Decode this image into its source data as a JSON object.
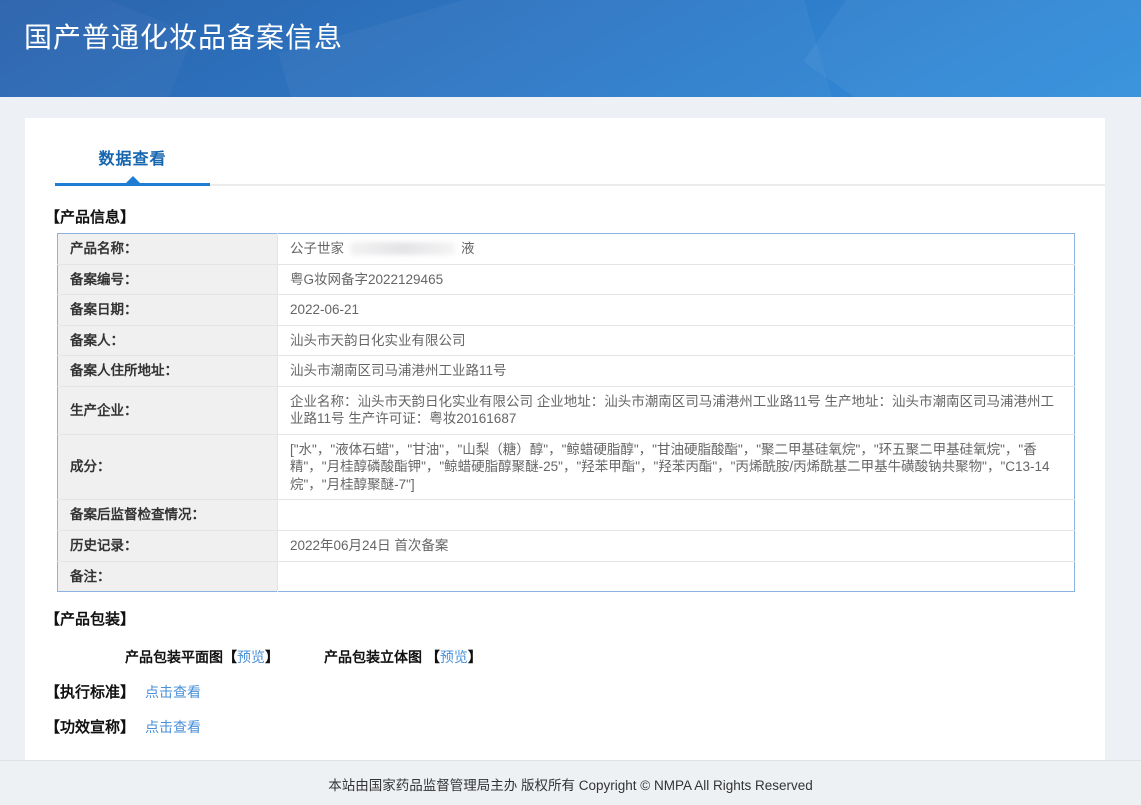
{
  "header": {
    "title": "国产普通化妆品备案信息"
  },
  "tabs": {
    "data_view_label": "数据查看"
  },
  "product_info": {
    "section_title": "【产品信息】",
    "rows": [
      {
        "label": "产品名称：",
        "redacted": true,
        "value_prefix": "公子世家",
        "value_suffix": "液"
      },
      {
        "label": "备案编号：",
        "value": "粤G妆网备字2022129465"
      },
      {
        "label": "备案日期：",
        "value": "2022-06-21"
      },
      {
        "label": "备案人：",
        "value": "汕头市天韵日化实业有限公司"
      },
      {
        "label": "备案人住所地址：",
        "value": "汕头市潮南区司马浦港州工业路11号"
      },
      {
        "label": "生产企业：",
        "value": "企业名称：汕头市天韵日化实业有限公司 企业地址：汕头市潮南区司马浦港州工业路11号 生产地址：汕头市潮南区司马浦港州工业路11号 生产许可证：粤妆20161687"
      },
      {
        "label": "成分：",
        "value": "[\"水\"，\"液体石蜡\"，\"甘油\"，\"山梨（糖）醇\"，\"鲸蜡硬脂醇\"，\"甘油硬脂酸酯\"，\"聚二甲基硅氧烷\"，\"环五聚二甲基硅氧烷\"，\"香精\"，\"月桂醇磷酸酯钾\"，\"鲸蜡硬脂醇聚醚-25\"，\"羟苯甲酯\"，\"羟苯丙酯\"，\"丙烯酰胺/丙烯酰基二甲基牛磺酸钠共聚物\"，\"C13-14 烷\"，\"月桂醇聚醚-7\"]"
      },
      {
        "label": "备案后监督检查情况：",
        "value": ""
      },
      {
        "label": "历史记录：",
        "value": "2022年06月24日 首次备案"
      },
      {
        "label": "备注：",
        "value": ""
      }
    ]
  },
  "packaging": {
    "section_title": "【产品包装】",
    "items": [
      {
        "label": "产品包装平面图",
        "bracket_open": "【",
        "link": "预览",
        "bracket_close": "】"
      },
      {
        "label": "产品包装立体图 ",
        "bracket_open": "【",
        "link": "预览",
        "bracket_close": "】"
      }
    ]
  },
  "standards": {
    "label": "【执行标准】",
    "link": "点击查看"
  },
  "efficacy": {
    "label": "【功效宣称】",
    "link": "点击查看"
  },
  "footer": {
    "copyright": "本站由国家药品监督管理局主办 版权所有 Copyright © NMPA All Rights Reserved"
  },
  "colors": {
    "accent_blue": "#1c7dd2",
    "tab_text": "#1565af",
    "link_blue": "#4a90d9",
    "table_border": "#8cb2de",
    "label_bg": "#f0f0f0",
    "header_grad_start": "#2b63ac",
    "header_grad_end": "#3190dc",
    "page_bg": "#edf1f6",
    "footer_bg": "#eef1f4"
  }
}
